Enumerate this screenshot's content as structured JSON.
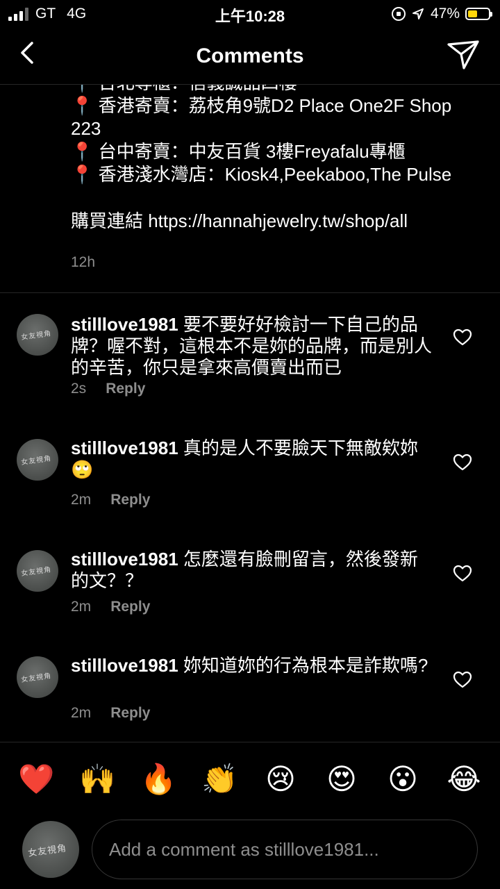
{
  "status_bar": {
    "carrier": "GT",
    "network": "4G",
    "time": "上午10:28",
    "battery_text": "47%",
    "battery_level": 0.47,
    "battery_color": "#ffd60a",
    "icons": [
      "signal-icon",
      "orientation-lock-icon",
      "location-arrow-icon",
      "battery-icon"
    ]
  },
  "nav": {
    "title": "Comments",
    "back_icon": "chevron-left-icon",
    "share_icon": "paper-plane-icon"
  },
  "caption": {
    "lines": [
      "📍 台北專櫃：信義誠品四樓",
      "📍 香港寄賣：荔枝角9號D2 Place One2F Shop",
      "223",
      "📍 台中寄賣：中友百貨 3樓Freyafalu專櫃",
      "📍 香港淺水灣店：Kiosk4,Peekaboo,The Pulse",
      "",
      "購買連結 https://hannahjewelry.tw/shop/all"
    ],
    "time": "12h"
  },
  "comments": [
    {
      "username": "stilllove1981",
      "text": "要不要好好檢討一下自己的品牌？喔不對，這根本不是妳的品牌，而是別人的辛苦，你只是拿來高價賣出而已",
      "time": "2s",
      "reply_label": "Reply"
    },
    {
      "username": "stilllove1981",
      "text": "真的是人不要臉天下無敵欸妳🙄",
      "time": "2m",
      "reply_label": "Reply"
    },
    {
      "username": "stilllove1981",
      "text": "怎麼還有臉刪留言，然後發新的文？？",
      "time": "2m",
      "reply_label": "Reply"
    },
    {
      "username": "stilllove1981",
      "text": "妳知道妳的行為根本是詐欺嗎?",
      "time": "2m",
      "reply_label": "Reply"
    }
  ],
  "emoji_bar": [
    "❤️",
    "🙌",
    "🔥",
    "👏",
    "😢",
    "😍",
    "😮",
    "😂"
  ],
  "composer": {
    "placeholder": "Add a comment as stilllove1981..."
  },
  "colors": {
    "background": "#000000",
    "text": "#ffffff",
    "secondary_text": "#8e8e8e",
    "divider": "#262626"
  }
}
